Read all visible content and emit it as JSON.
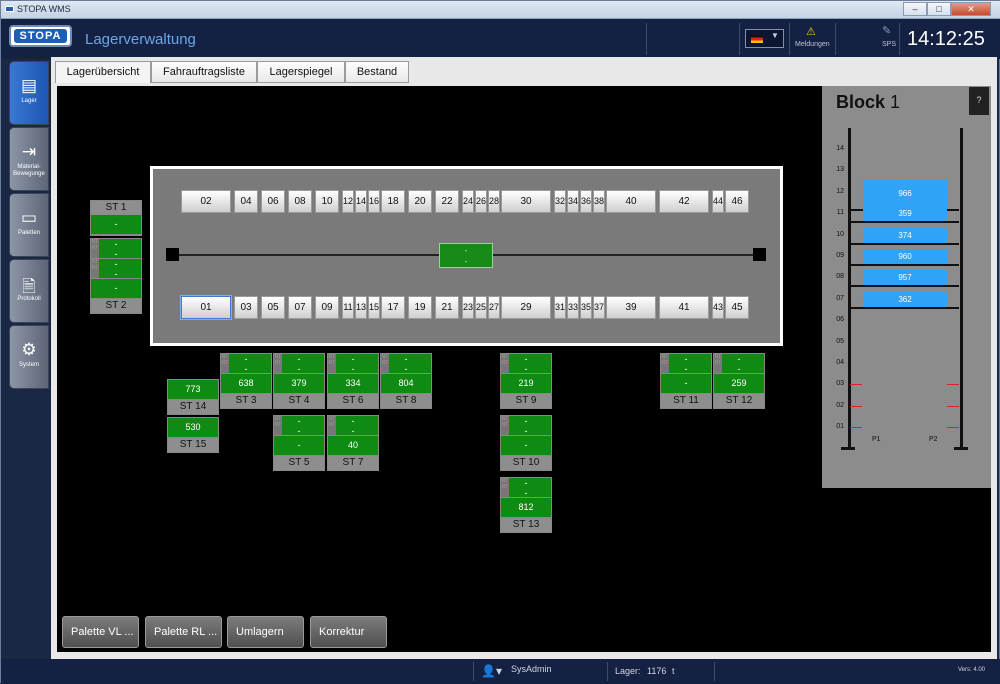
{
  "window": {
    "title": "STOPA WMS",
    "controls": {
      "min": "–",
      "max": "□",
      "close": "✕"
    }
  },
  "header": {
    "logo": "STOPA",
    "app_title": "Lagerverwaltung",
    "warning_icon": "⚠",
    "warning_label": "Meldungen",
    "sps_label": "SPS",
    "clock": "14:12:25"
  },
  "sidebar": {
    "items": [
      {
        "label": "Lager",
        "icon": "▤"
      },
      {
        "label": "Material-\nBewegunge",
        "icon": "⇥"
      },
      {
        "label": "Paletten",
        "icon": "▭"
      },
      {
        "label": "Protokoll",
        "icon": "🗎"
      },
      {
        "label": "System",
        "icon": "⚙"
      }
    ]
  },
  "tabs": [
    "Lagerübersicht",
    "Fahrauftragsliste",
    "Lagerspiegel",
    "Bestand"
  ],
  "aisle": {
    "top_bins": [
      "02",
      "04",
      "06",
      "08",
      "10",
      "12",
      "14",
      "16",
      "18",
      "20",
      "22",
      "24",
      "26",
      "28",
      "30",
      "32",
      "34",
      "36",
      "38",
      "40",
      "42",
      "44",
      "46"
    ],
    "bottom_bins": [
      "01",
      "03",
      "05",
      "07",
      "09",
      "11",
      "13",
      "15",
      "17",
      "19",
      "21",
      "23",
      "25",
      "27",
      "29",
      "31",
      "33",
      "35",
      "37",
      "39",
      "41",
      "43",
      "45"
    ],
    "selected_bin": "01",
    "shuttle": {
      "line1": "-",
      "line2": "-"
    }
  },
  "stations": {
    "st1": {
      "label": "ST 1",
      "value": "-"
    },
    "st2": {
      "label": "ST 2",
      "value": "-",
      "extra": [
        "- / -",
        "- / -"
      ]
    },
    "st14": {
      "label": "ST 14",
      "value": "773"
    },
    "st15": {
      "label": "ST 15",
      "value": "530"
    },
    "st3": {
      "label": "ST 3",
      "value": "638"
    },
    "st4": {
      "label": "ST 4",
      "value": "379"
    },
    "st6": {
      "label": "ST 6",
      "value": "334"
    },
    "st8": {
      "label": "ST 8",
      "value": "804"
    },
    "st5": {
      "label": "ST 5",
      "value": "-"
    },
    "st7": {
      "label": "ST 7",
      "value": "40"
    },
    "st9": {
      "label": "ST 9",
      "value": "219"
    },
    "st10": {
      "label": "ST 10",
      "value": "-"
    },
    "st13": {
      "label": "ST 13",
      "value": "812"
    },
    "st11": {
      "label": "ST 11",
      "value": "-"
    },
    "st12": {
      "label": "ST 12",
      "value": "259"
    },
    "dash": "-",
    "nt": "NT NT"
  },
  "buttons": [
    "Palette VL ...",
    "Palette RL ...",
    "Umlagern",
    "Korrektur"
  ],
  "block": {
    "title": "Block",
    "number": "1",
    "help": "?",
    "levels": [
      "14",
      "13",
      "12",
      "11",
      "10",
      "09",
      "08",
      "07",
      "06",
      "05",
      "04",
      "03",
      "02",
      "01"
    ],
    "cargo": [
      {
        "level": "12",
        "value": "966"
      },
      {
        "level": "11",
        "value": "359"
      },
      {
        "level": "10",
        "value": "374"
      },
      {
        "level": "09",
        "value": "960"
      },
      {
        "level": "08",
        "value": "957"
      },
      {
        "level": "07",
        "value": "362"
      }
    ],
    "p1": "P1",
    "p2": "P2"
  },
  "status": {
    "user": "SysAdmin",
    "lager_label": "Lager:",
    "lager_value": "1176",
    "unit": "t",
    "version": "Vers: 4.00"
  }
}
